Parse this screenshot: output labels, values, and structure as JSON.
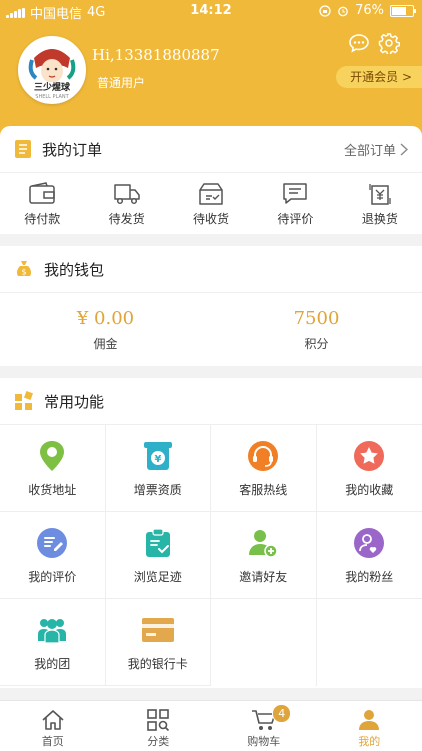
{
  "status_bar": {
    "carrier": "中国电信",
    "network": "4G",
    "time": "14:12",
    "battery": "76%",
    "battery_level": 0.76
  },
  "header": {
    "greeting": "Hi,13381880887",
    "member_level": "普通用户",
    "vip_button": "开通会员 >",
    "avatar_text": "三少煋球",
    "avatar_subtext": "SHELL PLANT"
  },
  "orders": {
    "title": "我的订单",
    "all_label": "全部订单",
    "items": [
      {
        "label": "待付款",
        "icon": "wallet-icon"
      },
      {
        "label": "待发货",
        "icon": "truck-icon"
      },
      {
        "label": "待收货",
        "icon": "package-icon"
      },
      {
        "label": "待评价",
        "icon": "comment-icon"
      },
      {
        "label": "退换货",
        "icon": "return-icon"
      }
    ]
  },
  "wallet": {
    "title": "我的钱包",
    "items": [
      {
        "value": "¥ 0.00",
        "label": "佣金"
      },
      {
        "value": "7500",
        "label": "积分"
      }
    ]
  },
  "functions": {
    "title": "常用功能",
    "items": [
      {
        "label": "收货地址",
        "icon": "location-pin-icon",
        "color": "#7dc043"
      },
      {
        "label": "增票资质",
        "icon": "invoice-icon",
        "color": "#2fb0c9"
      },
      {
        "label": "客服热线",
        "icon": "headset-icon",
        "color": "#f07f26"
      },
      {
        "label": "我的收藏",
        "icon": "star-icon",
        "color": "#ef6a5a"
      },
      {
        "label": "我的评价",
        "icon": "edit-comment-icon",
        "color": "#6d8de0"
      },
      {
        "label": "浏览足迹",
        "icon": "clipboard-check-icon",
        "color": "#27b5a7"
      },
      {
        "label": "邀请好友",
        "icon": "add-user-icon",
        "color": "#79c04a"
      },
      {
        "label": "我的粉丝",
        "icon": "fans-icon",
        "color": "#9a66c9"
      },
      {
        "label": "我的团",
        "icon": "group-icon",
        "color": "#27b5a7"
      },
      {
        "label": "我的银行卡",
        "icon": "bank-card-icon",
        "color": "#e2a84b"
      }
    ]
  },
  "tabbar": {
    "items": [
      {
        "label": "首页",
        "icon": "home-icon"
      },
      {
        "label": "分类",
        "icon": "category-icon"
      },
      {
        "label": "购物车",
        "icon": "cart-icon",
        "badge": "4"
      },
      {
        "label": "我的",
        "icon": "user-icon"
      }
    ]
  },
  "colors": {
    "brand": "#f0b93a",
    "accent": "#e0a53a"
  }
}
